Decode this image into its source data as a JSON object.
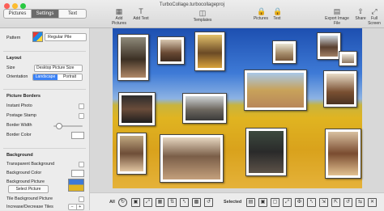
{
  "window": {
    "document_title": "TurboCollage.turbocollageproj"
  },
  "tabs": [
    {
      "label": "Pictures"
    },
    {
      "label": "Settings"
    },
    {
      "label": "Text"
    }
  ],
  "toolbar": {
    "add_pictures": "Add Pictures",
    "add_text": "Add Text",
    "templates": "Templates",
    "pictures": "Pictures",
    "text": "Text",
    "export": "Export Image File",
    "share": "Share",
    "full_screen": "Full Screen"
  },
  "settings": {
    "pattern_label": "Pattern",
    "pattern_value": "Regular Pile",
    "layout_header": "Layout",
    "size_label": "Size",
    "size_value": "Desktop Picture Size",
    "orientation_label": "Orientation",
    "orientation_landscape": "Landscape",
    "orientation_portrait": "Portrait",
    "borders_header": "Picture Borders",
    "instant_photo": "Instant Photo",
    "postage_stamp": "Postage Stamp",
    "border_width": "Border Width",
    "border_color": "Border Color",
    "background_header": "Background",
    "transparent_bg": "Transparent Background",
    "bg_color": "Background Color",
    "bg_picture": "Background Picture",
    "select_picture": "Select Picture",
    "tile_bg": "Tile Background Picture",
    "inc_dec_tiles": "Increase/Decrease Tiles"
  },
  "bottom": {
    "all_label": "All",
    "selected_label": "Selected"
  },
  "colors": {
    "sky": "#2f68c8",
    "field": "#e0b421",
    "segment_active": "#6b6b6b",
    "landscape_active": "#3b82f6"
  }
}
